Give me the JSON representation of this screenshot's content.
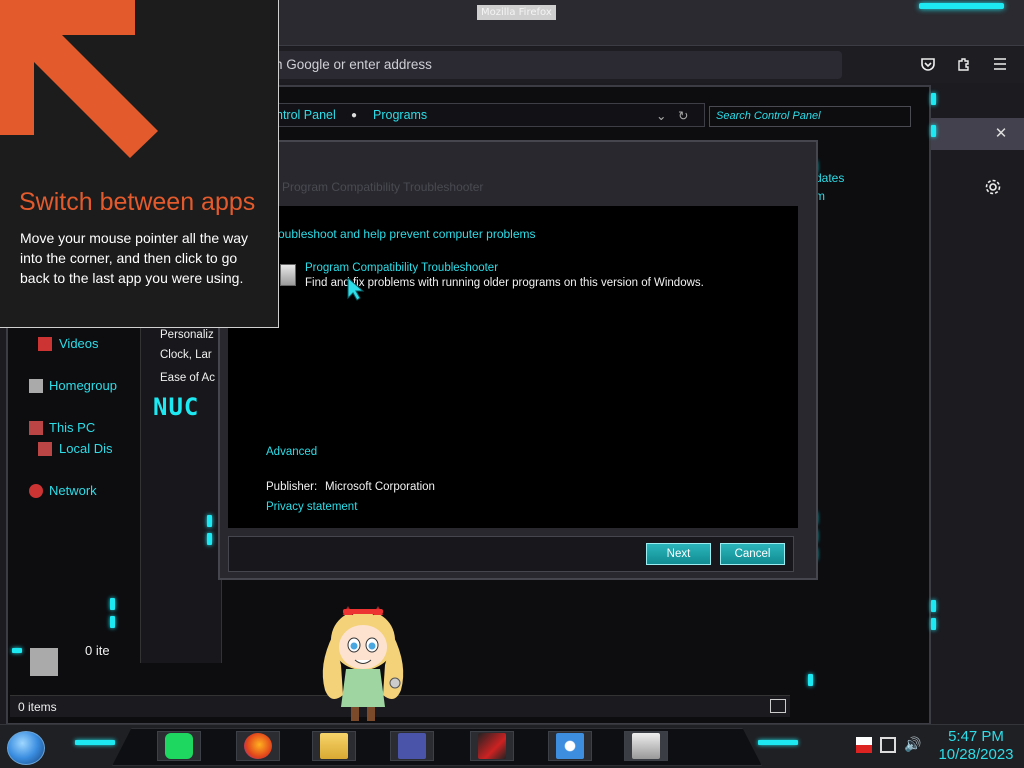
{
  "firefox": {
    "window_title": "Mozilla Firefox",
    "url_placeholder": "Search with Google or enter address",
    "url_visible": "n Google or enter address",
    "icons": [
      "pocket-icon",
      "extensions-icon",
      "menu-icon",
      "settings-icon",
      "close-icon"
    ]
  },
  "explorer": {
    "breadcrumb": [
      "ntrol Panel",
      "Programs"
    ],
    "search_placeholder": "Search Control Panel",
    "nav": [
      {
        "label": "Videos",
        "icon": "videos-icon"
      },
      {
        "label": "Homegroup",
        "icon": "homegroup-icon"
      },
      {
        "label": "This PC",
        "icon": "this-pc-icon"
      },
      {
        "label": "Local Dis",
        "icon": "local-disk-icon"
      },
      {
        "label": "Network",
        "icon": "network-icon"
      }
    ],
    "mid": [
      "Personaliz",
      "Clock, Lar",
      "Ease of Ac"
    ],
    "right": [
      "dates",
      "m"
    ],
    "status": "0 items",
    "status2": "0 ite"
  },
  "dialog": {
    "title": "Program Compatibility Troubleshooter",
    "heading": "oubleshoot and help prevent computer problems",
    "item_title": "Program Compatibility Troubleshooter",
    "item_desc": "Find and fix problems with running older programs on this version of Windows.",
    "advanced": "Advanced",
    "publisher_label": "Publisher:",
    "publisher_value": "Microsoft Corporation",
    "privacy": "Privacy statement",
    "next": "Next",
    "cancel": "Cancel"
  },
  "tip": {
    "title": "Switch between apps",
    "body": "Move your mouse pointer all the way into the corner, and then click to go back to the last app you were using."
  },
  "taskbar": {
    "apps": [
      "spotify-icon",
      "firefox-icon",
      "file-explorer-icon",
      "window-icon",
      "game-icon",
      "weather-icon",
      "control-panel-icon"
    ],
    "tray": [
      "flag-icon",
      "network-icon",
      "volume-icon"
    ],
    "time": "5:47 PM",
    "date": "10/28/2023"
  },
  "colors": {
    "accent": "#1de9f3",
    "link": "#2ddde8",
    "tip_title": "#e35a2c"
  }
}
